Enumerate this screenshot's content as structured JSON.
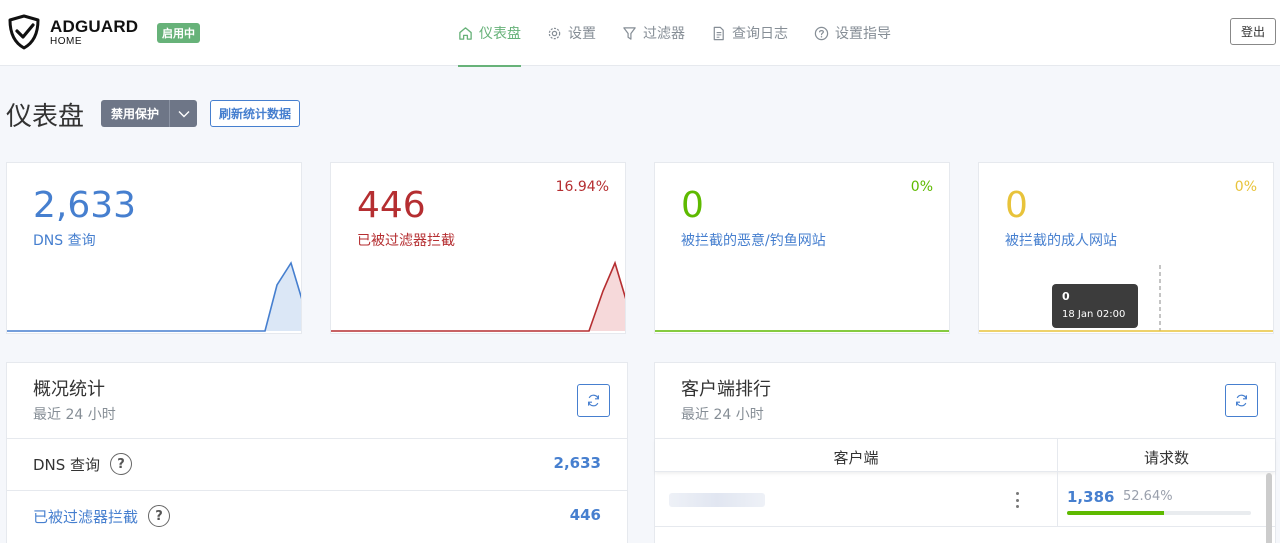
{
  "brand": {
    "title": "ADGUARD",
    "subtitle": "HOME",
    "status": "启用中"
  },
  "nav": [
    {
      "label": "仪表盘",
      "icon": "home-icon",
      "active": true
    },
    {
      "label": "设置",
      "icon": "gear-icon"
    },
    {
      "label": "过滤器",
      "icon": "filter-icon"
    },
    {
      "label": "查询日志",
      "icon": "document-icon"
    },
    {
      "label": "设置指导",
      "icon": "help-circle-icon"
    }
  ],
  "logout_label": "登出",
  "page": {
    "title": "仪表盘",
    "disable_protection": "禁用保护",
    "refresh_stats": "刷新统计数据"
  },
  "colors": {
    "blue": "#467fcf",
    "red": "#b52e31",
    "green": "#67b279",
    "yellow": "#e8c33a"
  },
  "stats": [
    {
      "value": "2,633",
      "label": "DNS 查询",
      "percent": "",
      "color": "#467fcf"
    },
    {
      "value": "446",
      "label": "已被过滤器拦截",
      "percent": "16.94%",
      "color": "#b52e31"
    },
    {
      "value": "0",
      "label": "被拦截的恶意/钓鱼网站",
      "percent": "0%",
      "color": "#5eba00"
    },
    {
      "value": "0",
      "label": "被拦截的成人网站",
      "percent": "0%",
      "color": "#e8c33a"
    }
  ],
  "tooltip": {
    "value": "0",
    "time": "18 Jan 02:00"
  },
  "overview": {
    "title": "概况统计",
    "subtitle": "最近 24 小时",
    "rows": [
      {
        "label": "DNS 查询",
        "value": "2,633"
      },
      {
        "label": "已被过滤器拦截",
        "value": "446"
      }
    ]
  },
  "clients": {
    "title": "客户端排行",
    "subtitle": "最近 24 小时",
    "col_client": "客户端",
    "col_requests": "请求数",
    "rows": [
      {
        "count": "1,386",
        "percent": "52.64%",
        "fraction": 0.5264
      }
    ]
  }
}
